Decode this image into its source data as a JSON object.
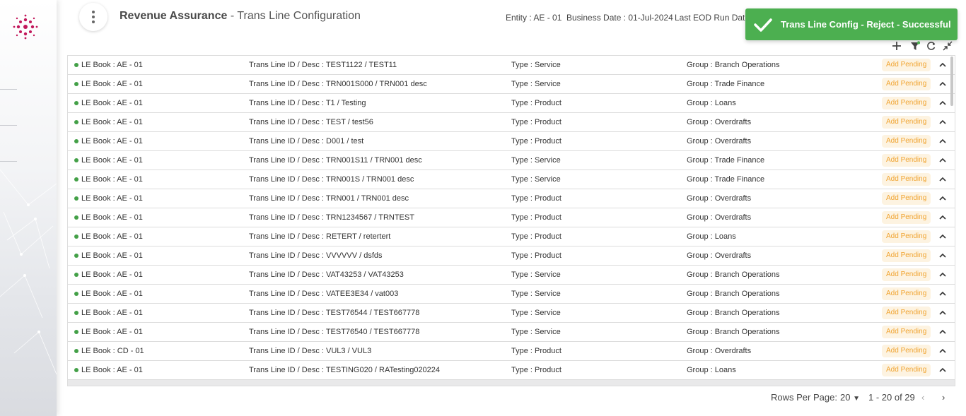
{
  "header": {
    "app_name": "Revenue Assurance",
    "separator": " - ",
    "page_name": "Trans Line Configuration",
    "entity": "Entity : AE - 01",
    "business_date": "Business Date : 01-Jul-2024",
    "last_eod": "Last EOD Run Date"
  },
  "toast": {
    "message": "Trans Line Config - Reject - Successful",
    "color": "#4caf50"
  },
  "toolbar": {
    "icons": [
      "add-icon",
      "filter-icon",
      "refresh-icon",
      "collapse-icon"
    ]
  },
  "rows": [
    {
      "le_book": "LE Book : AE - 01",
      "trans_line": "Trans Line ID / Desc : TEST1122 / TEST11",
      "type": "Type : Service",
      "group": "Group : Branch Operations",
      "status": "Add Pending"
    },
    {
      "le_book": "LE Book : AE - 01",
      "trans_line": "Trans Line ID / Desc : TRN001S000 / TRN001 desc",
      "type": "Type : Service",
      "group": "Group : Trade Finance",
      "status": "Add Pending"
    },
    {
      "le_book": "LE Book : AE - 01",
      "trans_line": "Trans Line ID / Desc : T1 / Testing",
      "type": "Type : Product",
      "group": "Group : Loans",
      "status": "Add Pending"
    },
    {
      "le_book": "LE Book : AE - 01",
      "trans_line": "Trans Line ID / Desc : TEST / test56",
      "type": "Type : Product",
      "group": "Group : Overdrafts",
      "status": "Add Pending"
    },
    {
      "le_book": "LE Book : AE - 01",
      "trans_line": "Trans Line ID / Desc : D001 / test",
      "type": "Type : Product",
      "group": "Group : Overdrafts",
      "status": "Add Pending"
    },
    {
      "le_book": "LE Book : AE - 01",
      "trans_line": "Trans Line ID / Desc : TRN001S11 / TRN001 desc",
      "type": "Type : Service",
      "group": "Group : Trade Finance",
      "status": "Add Pending"
    },
    {
      "le_book": "LE Book : AE - 01",
      "trans_line": "Trans Line ID / Desc : TRN001S / TRN001 desc",
      "type": "Type : Service",
      "group": "Group : Trade Finance",
      "status": "Add Pending"
    },
    {
      "le_book": "LE Book : AE - 01",
      "trans_line": "Trans Line ID / Desc : TRN001 / TRN001 desc",
      "type": "Type : Product",
      "group": "Group : Overdrafts",
      "status": "Add Pending"
    },
    {
      "le_book": "LE Book : AE - 01",
      "trans_line": "Trans Line ID / Desc : TRN1234567 / TRNTEST",
      "type": "Type : Product",
      "group": "Group : Overdrafts",
      "status": "Add Pending"
    },
    {
      "le_book": "LE Book : AE - 01",
      "trans_line": "Trans Line ID / Desc : RETERT / retertert",
      "type": "Type : Product",
      "group": "Group : Loans",
      "status": "Add Pending"
    },
    {
      "le_book": "LE Book : AE - 01",
      "trans_line": "Trans Line ID / Desc : VVVVVV / dsfds",
      "type": "Type : Product",
      "group": "Group : Overdrafts",
      "status": "Add Pending"
    },
    {
      "le_book": "LE Book : AE - 01",
      "trans_line": "Trans Line ID / Desc : VAT43253 / VAT43253",
      "type": "Type : Service",
      "group": "Group : Branch Operations",
      "status": "Add Pending"
    },
    {
      "le_book": "LE Book : AE - 01",
      "trans_line": "Trans Line ID / Desc : VATEE3E34 / vat003",
      "type": "Type : Service",
      "group": "Group : Branch Operations",
      "status": "Add Pending"
    },
    {
      "le_book": "LE Book : AE - 01",
      "trans_line": "Trans Line ID / Desc : TEST76544 / TEST667778",
      "type": "Type : Service",
      "group": "Group : Branch Operations",
      "status": "Add Pending"
    },
    {
      "le_book": "LE Book : AE - 01",
      "trans_line": "Trans Line ID / Desc : TEST76540 / TEST667778",
      "type": "Type : Service",
      "group": "Group : Branch Operations",
      "status": "Add Pending"
    },
    {
      "le_book": "LE Book : CD - 01",
      "trans_line": "Trans Line ID / Desc : VUL3 / VUL3",
      "type": "Type : Product",
      "group": "Group : Overdrafts",
      "status": "Add Pending"
    },
    {
      "le_book": "LE Book : AE - 01",
      "trans_line": "Trans Line ID / Desc : TESTING020 / RATesting020224",
      "type": "Type : Product",
      "group": "Group : Loans",
      "status": "Add Pending"
    }
  ],
  "footer": {
    "rows_per_page_label": "Rows Per Page:",
    "rows_per_page_value": "20",
    "range": "1 - 20 of 29"
  },
  "colors": {
    "status_dot": "#43a047",
    "badge_bg": "#fdf3e1",
    "badge_text": "#f0a431"
  }
}
